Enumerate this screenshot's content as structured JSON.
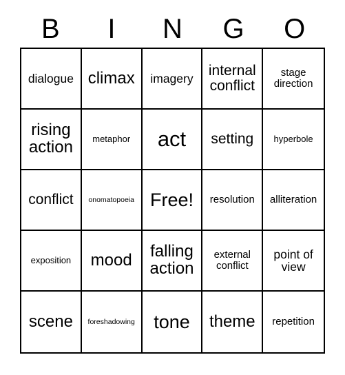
{
  "header": {
    "letters": [
      "B",
      "I",
      "N",
      "G",
      "O"
    ]
  },
  "grid": {
    "rows": [
      [
        {
          "label": "dialogue",
          "size": "fs-lg",
          "lines": 1
        },
        {
          "label": "climax",
          "size": "fs-2xl",
          "lines": 1
        },
        {
          "label": "imagery",
          "size": "fs-lg",
          "lines": 1
        },
        {
          "label": "internal conflict",
          "size": "fs-xl",
          "lines": 2
        },
        {
          "label": "stage direction",
          "size": "fs-md",
          "lines": 2
        }
      ],
      [
        {
          "label": "rising action",
          "size": "fs-2xl",
          "lines": 2
        },
        {
          "label": "metaphor",
          "size": "fs-sm",
          "lines": 1
        },
        {
          "label": "act",
          "size": "fs-4xl",
          "lines": 1
        },
        {
          "label": "setting",
          "size": "fs-xl",
          "lines": 1
        },
        {
          "label": "hyperbole",
          "size": "fs-sm",
          "lines": 1
        }
      ],
      [
        {
          "label": "conflict",
          "size": "fs-xl",
          "lines": 1
        },
        {
          "label": "onomatopoeia",
          "size": "fs-xs",
          "lines": 1
        },
        {
          "label": "Free!",
          "size": "fs-3xl",
          "lines": 1
        },
        {
          "label": "resolution",
          "size": "fs-md",
          "lines": 1
        },
        {
          "label": "alliteration",
          "size": "fs-md",
          "lines": 1
        }
      ],
      [
        {
          "label": "exposition",
          "size": "fs-sm",
          "lines": 1
        },
        {
          "label": "mood",
          "size": "fs-2xl",
          "lines": 1
        },
        {
          "label": "falling action",
          "size": "fs-2xl",
          "lines": 2
        },
        {
          "label": "external conflict",
          "size": "fs-md",
          "lines": 2
        },
        {
          "label": "point of view",
          "size": "fs-lg",
          "lines": 2
        }
      ],
      [
        {
          "label": "scene",
          "size": "fs-2xl",
          "lines": 1
        },
        {
          "label": "foreshadowing",
          "size": "fs-xs",
          "lines": 1
        },
        {
          "label": "tone",
          "size": "fs-3xl",
          "lines": 1
        },
        {
          "label": "theme",
          "size": "fs-2xl",
          "lines": 1
        },
        {
          "label": "repetition",
          "size": "fs-md",
          "lines": 1
        }
      ]
    ]
  },
  "colors": {
    "border": "#000000",
    "text": "#000000",
    "background": "#ffffff"
  }
}
